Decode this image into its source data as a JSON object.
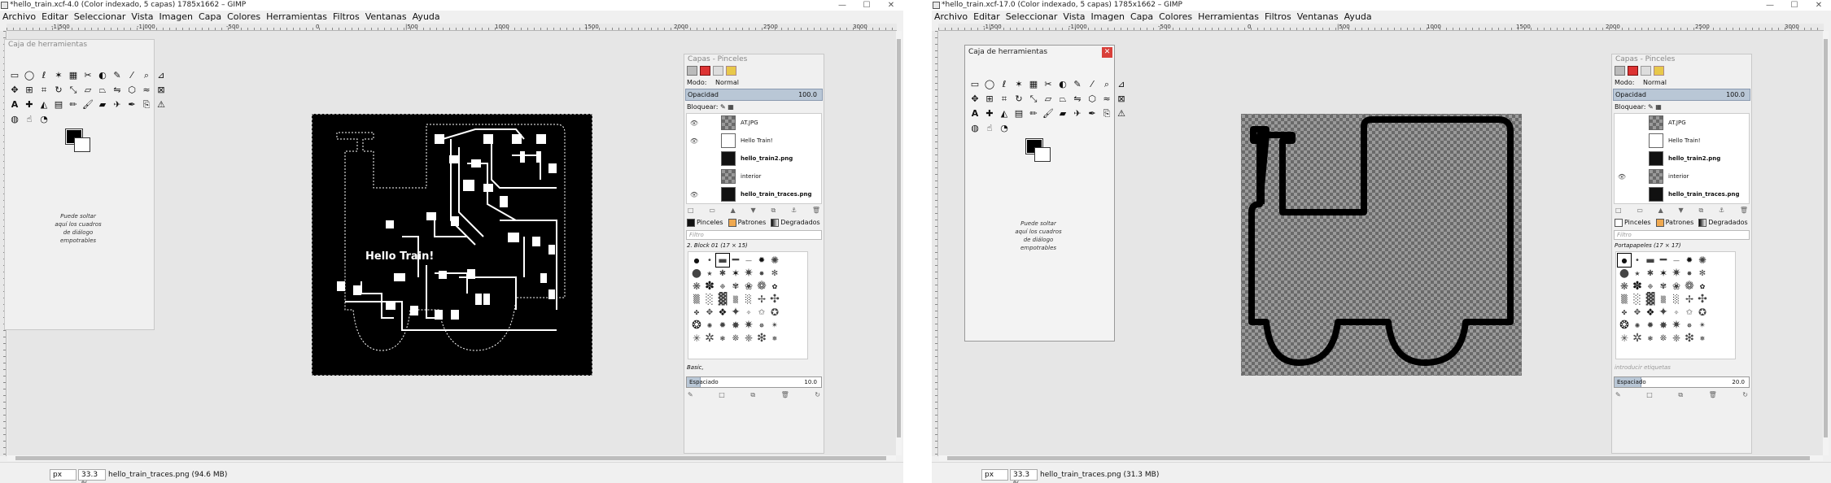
{
  "windows": [
    {
      "title": "*hello_train.xcf-4.0 (Color indexado, 5 capas) 1785x1662 – GIMP",
      "status": {
        "unit": "px",
        "zoom": "33.3 %",
        "text": "hello_train_traces.png (94.6 MB)"
      },
      "ruler_labels": [
        "-1|500",
        "-1|000",
        "-500",
        "0",
        "|500",
        "1000",
        "1500",
        "2000",
        "2500",
        "3000"
      ],
      "toolbox": {
        "title": "Caja de herramientas",
        "drop_note": "Puede soltar aquí los cuadros de diálogo empotrables"
      },
      "image": {
        "text": "Hello Train!"
      },
      "dock": {
        "title": "Capas - Pinceles",
        "mode_label": "Modo:",
        "mode_value": "Normal",
        "opacity_label": "Opacidad",
        "opacity_value": "100.0",
        "lock_label": "Bloquear:",
        "layers": [
          {
            "name": "AT.JPG",
            "visible": true,
            "bold": false
          },
          {
            "name": "Hello Train!",
            "visible": true,
            "bold": false
          },
          {
            "name": "hello_train2.png",
            "visible": false,
            "bold": true
          },
          {
            "name": "interior",
            "visible": false,
            "bold": false
          },
          {
            "name": "hello_train_traces.png",
            "visible": true,
            "bold": true
          }
        ],
        "tabs": [
          "Pinceles",
          "Patrones",
          "Degradados"
        ],
        "filter": "Filtro",
        "brush_name": "2. Block 01 (17 × 15)",
        "preset_label": "Basic,",
        "spacing_label": "Espaciado",
        "spacing_value": "10.0",
        "spacing_fraction": 0.1
      }
    },
    {
      "title": "*hello_train.xcf-17.0 (Color indexado, 5 capas) 1785x1662 – GIMP",
      "status": {
        "unit": "px",
        "zoom": "33.3 %",
        "text": "hello_train_traces.png (31.3 MB)"
      },
      "ruler_labels": [
        "-1|500",
        "-1|000",
        "-500",
        "0",
        "|500",
        "1000",
        "1500",
        "2000",
        "2500",
        "3000"
      ],
      "toolbox": {
        "title": "Caja de herramientas",
        "drop_note": "Puede soltar aquí los cuadros de diálogo empotrables"
      },
      "image": {
        "text": ""
      },
      "dock": {
        "title": "Capas - Pinceles",
        "mode_label": "Modo:",
        "mode_value": "Normal",
        "opacity_label": "Opacidad",
        "opacity_value": "100.0",
        "lock_label": "Bloquear:",
        "layers": [
          {
            "name": "AT.JPG",
            "visible": false,
            "bold": false
          },
          {
            "name": "Hello Train!",
            "visible": false,
            "bold": false
          },
          {
            "name": "hello_train2.png",
            "visible": false,
            "bold": true
          },
          {
            "name": "interior",
            "visible": true,
            "bold": false
          },
          {
            "name": "hello_train_traces.png",
            "visible": false,
            "bold": true
          }
        ],
        "tabs": [
          "Pinceles",
          "Patrones",
          "Degradados"
        ],
        "filter": "Filtro",
        "brush_name": "Portapapeles (17 × 17)",
        "preset_label": "introducir etiquetas",
        "spacing_label": "Espaciado",
        "spacing_value": "20.0",
        "spacing_fraction": 0.2
      }
    }
  ],
  "menu": [
    "Archivo",
    "Editar",
    "Seleccionar",
    "Vista",
    "Imagen",
    "Capa",
    "Colores",
    "Herramientas",
    "Filtros",
    "Ventanas",
    "Ayuda"
  ],
  "window_buttons": {
    "minimize": "—",
    "maximize": "☐",
    "close": "✕"
  },
  "dock_buttons": [
    "□",
    "▭",
    "▲",
    "▼",
    "⧉",
    "⚓",
    "🗑"
  ],
  "colors": {
    "selection_blue": "#b9c7d6",
    "close_red": "#d9403a"
  }
}
